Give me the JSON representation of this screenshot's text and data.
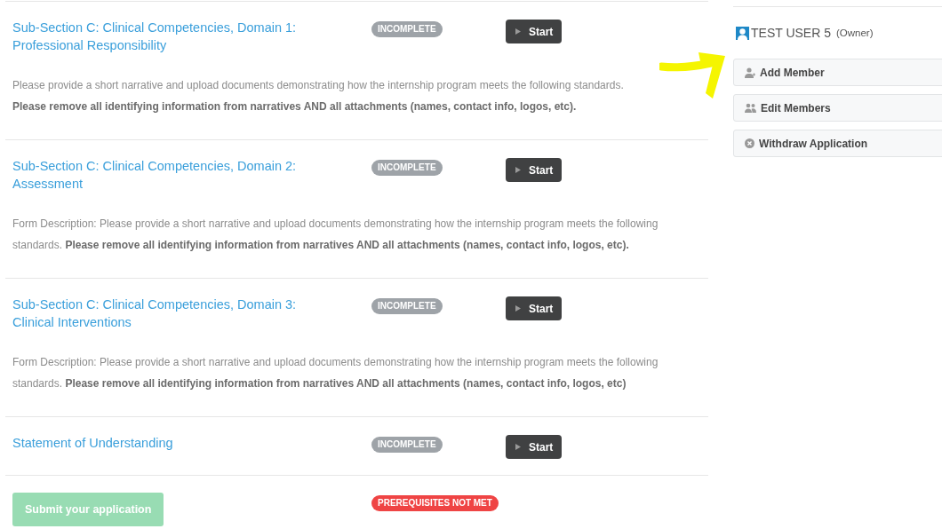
{
  "sections": [
    {
      "title": "Sub-Section C: Clinical Competencies, Domain 1: Professional Responsibility",
      "status": "INCOMPLETE",
      "action": "Start",
      "description": "Please provide a short narrative and upload documents demonstrating how the internship program meets the following standards.",
      "note": "Please remove all identifying information from narratives AND all attachments (names, contact info, logos, etc)."
    },
    {
      "title": "Sub-Section C: Clinical Competencies, Domain 2: Assessment",
      "status": "INCOMPLETE",
      "action": "Start",
      "description": "Form Description: Please provide a short narrative and upload documents demonstrating how the internship program meets the following standards. **Please remove all identifying information from narratives AND all attachments (names, contact info, logos, etc).**"
    },
    {
      "title": "Sub-Section C: Clinical Competencies, Domain 3: Clinical Interventions",
      "status": "INCOMPLETE",
      "action": "Start",
      "description": "Form Description: Please provide a short narrative and upload documents demonstrating how the internship program meets the following standards. **Please remove all identifying information from narratives AND all attachments (names, contact info, logos, etc)**"
    },
    {
      "title": "Statement of Understanding",
      "status": "INCOMPLETE",
      "action": "Start"
    }
  ],
  "submit": {
    "label": "Submit your application",
    "disabled": true,
    "status": "PREREQUISITES NOT MET"
  },
  "sidebar": {
    "user": "TEST USER 5",
    "role": "(Owner)",
    "actions": [
      {
        "label": "Add Member"
      },
      {
        "label": "Edit Members"
      },
      {
        "label": "Withdraw Application"
      }
    ]
  }
}
